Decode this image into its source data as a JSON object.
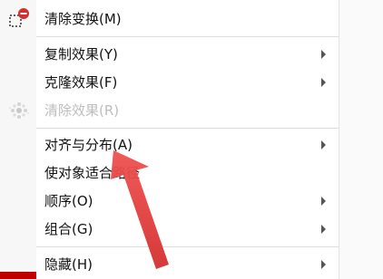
{
  "menu": {
    "items": [
      {
        "label": "清除变换(M)",
        "icon": "clear-transform-icon",
        "submenu": false,
        "disabled": false
      },
      {
        "label": "复制效果(Y)",
        "submenu": true,
        "disabled": false
      },
      {
        "label": "克隆效果(F)",
        "submenu": true,
        "disabled": false
      },
      {
        "label": "清除效果(R)",
        "icon": "clear-effect-icon",
        "submenu": false,
        "disabled": true
      },
      {
        "label": "对齐与分布(A)",
        "submenu": true,
        "disabled": false
      },
      {
        "label": "使对象适合路径",
        "submenu": false,
        "disabled": false
      },
      {
        "label": "顺序(O)",
        "submenu": true,
        "disabled": false
      },
      {
        "label": "组合(G)",
        "submenu": true,
        "disabled": false
      },
      {
        "label": "隐藏(H)",
        "submenu": true,
        "disabled": false
      }
    ]
  },
  "colors": {
    "annotation_arrow": "#e53935",
    "disabled_text": "#bdbdbd",
    "clear_badge": "#d32f2f"
  }
}
